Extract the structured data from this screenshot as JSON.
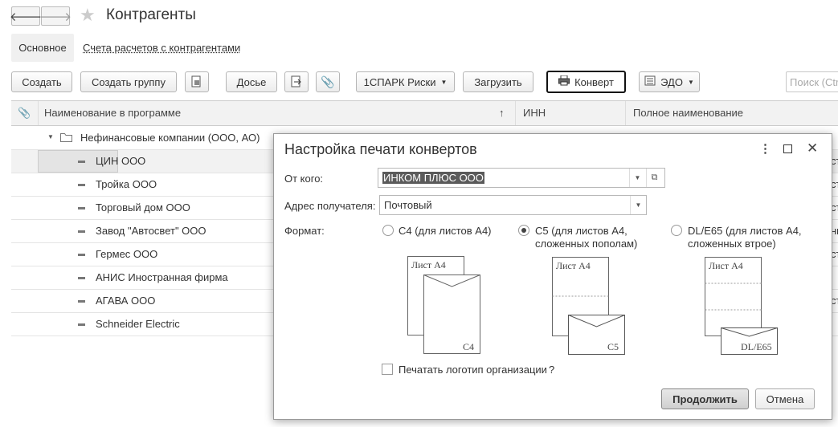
{
  "window": {
    "title": "Контрагенты"
  },
  "tabs": {
    "main": "Основное",
    "link": "Счета расчетов с контрагентами"
  },
  "toolbar": {
    "create": "Создать",
    "create_group": "Создать группу",
    "dossier": "Досье",
    "spark": "1СПАРК Риски",
    "load": "Загрузить",
    "envelope": "Конверт",
    "edo": "ЭДО",
    "search_placeholder": "Поиск (Ctrl+F)"
  },
  "table": {
    "headers": {
      "name": "Наименование в программе",
      "inn": "ИНН",
      "full_name": "Полное наименование"
    },
    "group": "Нефинансовые компании (ООО, АО)",
    "rows": [
      "ЦИН ООО",
      "Тройка ООО",
      "Торговый дом ООО",
      "Завод \"Автосвет\" ООО",
      "Гермес ООО",
      "АНИС  Иностранная фирма",
      "АГАВА  ООО",
      "Schneider Electric"
    ],
    "edge_text": [
      "ст",
      "ст",
      "ст",
      "нн",
      "ст",
      "",
      "ст",
      ""
    ]
  },
  "dialog": {
    "title": "Настройка печати конвертов",
    "from_label": "От кого:",
    "from_value": "ИНКОМ ПЛЮС ООО",
    "address_label": "Адрес получателя:",
    "address_value": "Почтовый",
    "format_label": "Формат:",
    "formats": [
      {
        "line1": "C4 (для листов A4)",
        "line2": "",
        "selected": false
      },
      {
        "line1": "C5 (для листов A4,",
        "line2": "сложенных пополам)",
        "selected": true
      },
      {
        "line1": "DL/E65 (для листов A4,",
        "line2": "сложенных втрое)",
        "selected": false
      }
    ],
    "sheet_label": "Лист А4",
    "env_labels": [
      "C4",
      "C5",
      "DL/E65"
    ],
    "print_logo": "Печатать логотип организации",
    "help_mark": "?",
    "continue": "Продолжить",
    "cancel": "Отмена"
  }
}
